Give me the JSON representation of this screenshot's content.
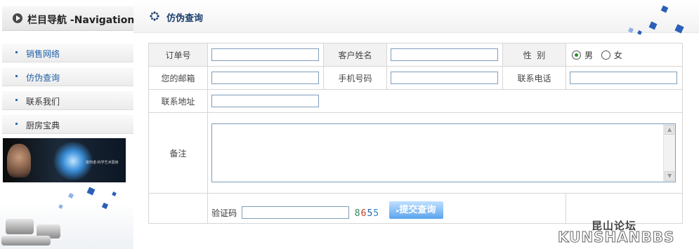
{
  "sidebar": {
    "title": "栏目导航 -Navigation",
    "items": [
      {
        "label": "销售网络"
      },
      {
        "label": "仿伪查询"
      },
      {
        "label": "联系我们"
      },
      {
        "label": "厨房宝典"
      }
    ],
    "banner_text": "度阿诺·科学艺术厨房"
  },
  "main": {
    "title": "仿伪查询"
  },
  "form": {
    "order_label": "订单号",
    "customer_label": "客户姓名",
    "gender_label": "性  别",
    "gender_options": [
      "男",
      "女"
    ],
    "gender_selected": "男",
    "email_label": "您的邮箱",
    "mobile_label": "手机号码",
    "phone_label": "联系电话",
    "address_label": "联系地址",
    "memo_label": "备注",
    "captcha_label": "验证码",
    "captcha_code": "8655",
    "submit_label": "提交查询"
  },
  "watermark": {
    "cn": "昆山论坛",
    "en": "KUNSHANBBS"
  },
  "colors": {
    "accent": "#1f5fa6",
    "captcha": [
      "#2e8b57",
      "#c0392b",
      "#1f5fa6",
      "#2e86c1"
    ]
  }
}
